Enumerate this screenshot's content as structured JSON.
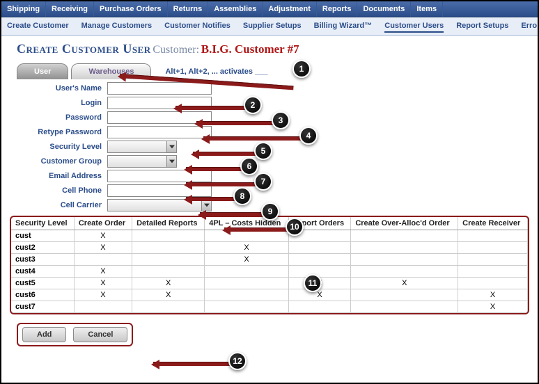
{
  "topnav": [
    "Shipping",
    "Receiving",
    "Purchase Orders",
    "Returns",
    "Assemblies",
    "Adjustment",
    "Reports",
    "Documents",
    "Items"
  ],
  "subnav": [
    "Create Customer",
    "Manage Customers",
    "Customer Notifies",
    "Supplier Setups",
    "Billing Wizard™",
    "Customer Users",
    "Report Setups",
    "Erro"
  ],
  "subnav_active_index": 5,
  "title": {
    "main": "Create Customer User",
    "cust_label": "Customer:",
    "cust_name": "B.I.G. Customer #7"
  },
  "tabs": {
    "user": "User",
    "warehouses": "Warehouses",
    "hint": "Alt+1, Alt+2, ... activates ___"
  },
  "form": {
    "users_name": "User's Name",
    "login": "Login",
    "password": "Password",
    "retype_password": "Retype Password",
    "security_level": "Security Level",
    "customer_group": "Customer Group",
    "email_address": "Email Address",
    "cell_phone": "Cell Phone",
    "cell_carrier": "Cell Carrier"
  },
  "grid": {
    "headers": [
      "Security Level",
      "Create Order",
      "Detailed Reports",
      "4PL – Costs Hidden",
      "Import Orders",
      "Create Over-Alloc'd Order",
      "Create Receiver"
    ],
    "rows": [
      {
        "level": "cust",
        "cols": [
          "X",
          "",
          "",
          "",
          "",
          ""
        ]
      },
      {
        "level": "cust2",
        "cols": [
          "X",
          "",
          "X",
          "",
          "",
          ""
        ]
      },
      {
        "level": "cust3",
        "cols": [
          "",
          "",
          "X",
          "",
          "",
          ""
        ]
      },
      {
        "level": "cust4",
        "cols": [
          "X",
          "",
          "",
          "",
          "",
          ""
        ]
      },
      {
        "level": "cust5",
        "cols": [
          "X",
          "X",
          "",
          "X",
          "X",
          ""
        ]
      },
      {
        "level": "cust6",
        "cols": [
          "X",
          "X",
          "",
          "X",
          "",
          "X"
        ]
      },
      {
        "level": "cust7",
        "cols": [
          "",
          "",
          "",
          "",
          "",
          "X"
        ]
      }
    ]
  },
  "buttons": {
    "add": "Add",
    "cancel": "Cancel"
  },
  "annotations": {
    "b1": "1",
    "b2": "2",
    "b3": "3",
    "b4": "4",
    "b5": "5",
    "b6": "6",
    "b7": "7",
    "b8": "8",
    "b9": "9",
    "b10": "10",
    "b11": "11",
    "b12": "12"
  }
}
